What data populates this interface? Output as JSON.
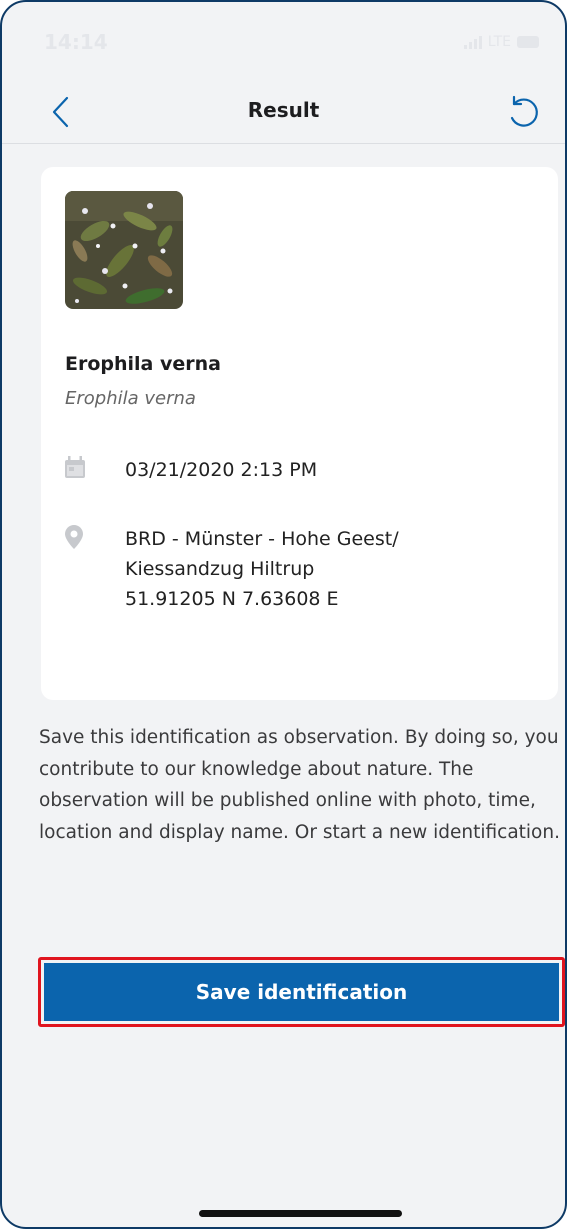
{
  "status_bar": {
    "time": "14:14",
    "network": "LTE"
  },
  "nav": {
    "title": "Result",
    "back_icon": "chevron-left-icon",
    "reset_icon": "undo-icon"
  },
  "result": {
    "common_name": "Erophila verna",
    "scientific_name": "Erophila verna",
    "datetime": "03/21/2020 2:13 PM",
    "location_line1": "BRD - Münster - Hohe Geest/",
    "location_line2": "Kiessandzug Hiltrup",
    "coordinates": "51.91205 N 7.63608 E"
  },
  "description": "Save this identification as observation. By doing so, you contribute to our knowledge about nature. The observation will be published online with photo, time, location and display name. Or start a new identification.",
  "actions": {
    "save_label": "Save identification"
  },
  "colors": {
    "primary": "#0b64ad",
    "highlight_border": "#e0141e",
    "background": "#f2f3f5"
  }
}
